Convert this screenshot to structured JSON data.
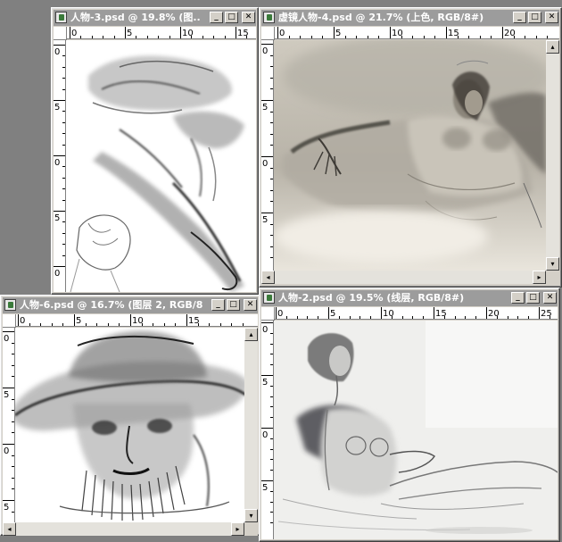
{
  "windows": {
    "w3": {
      "title": "人物-3.psd @ 19.8% (图...",
      "hticks": [
        "0",
        "5",
        "10",
        "15"
      ],
      "vticks": [
        "0",
        "5",
        "0",
        "5",
        "0"
      ]
    },
    "w4": {
      "title": "虚镜人物-4.psd @ 21.7% (上色, RGB/8#)",
      "hticks": [
        "0",
        "5",
        "10",
        "15",
        "20"
      ],
      "vticks": [
        "0",
        "5",
        "0",
        "5"
      ]
    },
    "w6": {
      "title": "人物-6.psd @ 16.7% (图层 2, RGB/8#)",
      "hticks": [
        "0",
        "5",
        "10",
        "15"
      ],
      "vticks": [
        "0",
        "5",
        "0",
        "5"
      ]
    },
    "w2": {
      "title": "人物-2.psd @ 19.5% (线层, RGB/8#)",
      "hticks": [
        "0",
        "5",
        "10",
        "15",
        "20",
        "25"
      ],
      "vticks": [
        "0",
        "5",
        "0",
        "5"
      ]
    }
  },
  "buttons": {
    "minimize": "_",
    "maximize": "□",
    "close": "✕"
  },
  "scroll": {
    "left": "◂",
    "right": "▸",
    "up": "▴",
    "down": "▾"
  },
  "colors": {
    "titlebar_inactive": "#9c9c9c",
    "frame": "#d4d0c8",
    "desktop": "#808080"
  }
}
